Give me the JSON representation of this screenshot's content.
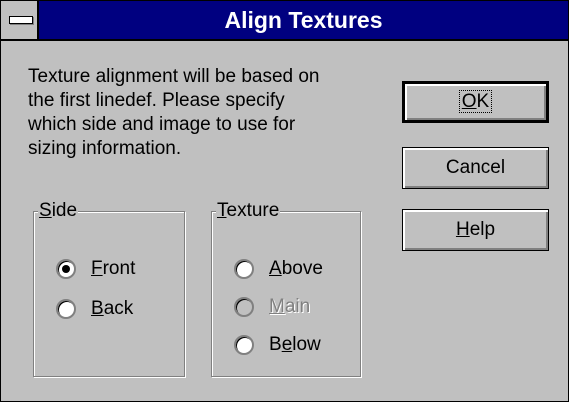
{
  "dialog": {
    "title": "Align Textures",
    "message_lines": [
      "Texture alignment will be based on",
      "the first linedef.  Please specify",
      "which side and image to use for",
      "sizing information."
    ]
  },
  "buttons": {
    "ok": {
      "mnemonic": "O",
      "rest": "K"
    },
    "cancel": "Cancel",
    "help": {
      "mnemonic": "H",
      "rest": "elp"
    }
  },
  "side_group": {
    "legend": {
      "mnemonic": "S",
      "rest": "ide"
    },
    "options": [
      {
        "mnemonic": "F",
        "rest": "ront",
        "selected": true,
        "enabled": true
      },
      {
        "mnemonic": "B",
        "rest": "ack",
        "selected": false,
        "enabled": true
      }
    ]
  },
  "texture_group": {
    "legend": {
      "mnemonic": "T",
      "rest": "exture"
    },
    "options": [
      {
        "mnemonic": "A",
        "rest": "bove",
        "selected": false,
        "enabled": true
      },
      {
        "mnemonic": "M",
        "rest": "ain",
        "selected": false,
        "enabled": false
      },
      {
        "pre": "B",
        "mnemonic": "e",
        "rest": "low",
        "selected": false,
        "enabled": true
      }
    ]
  },
  "colors": {
    "titlebar": "#000080",
    "face": "#c0c0c0",
    "disabled_text": "#808080"
  }
}
